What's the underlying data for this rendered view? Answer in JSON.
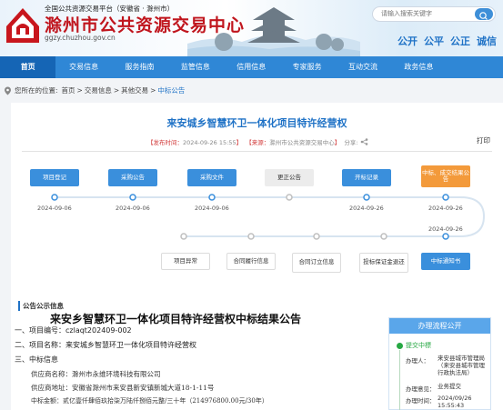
{
  "header": {
    "platform": "全国公共资源交易平台（安徽省 · 滁州市）",
    "title": "滁州市公共资源交易中心",
    "domain": "ggzy.chuzhou.gov.cn",
    "search_placeholder": "请输入搜索关键字",
    "slogans": [
      "公开",
      "公平",
      "公正",
      "诚信"
    ]
  },
  "nav": [
    {
      "label": "首页",
      "active": true
    },
    {
      "label": "交易信息",
      "active": false
    },
    {
      "label": "服务指南",
      "active": false
    },
    {
      "label": "监管信息",
      "active": false
    },
    {
      "label": "信用信息",
      "active": false
    },
    {
      "label": "专家服务",
      "active": false
    },
    {
      "label": "互动交流",
      "active": false
    },
    {
      "label": "政务信息",
      "active": false
    }
  ],
  "breadcrumb": {
    "prefix": "您所在的位置:",
    "items": [
      "首页",
      "交易信息",
      "其他交易"
    ],
    "current": "中标公告",
    "separator": ">"
  },
  "article": {
    "title": "来安城乡智慧环卫一体化项目特许经营权",
    "publish_label": "【发布时间：",
    "publish_time": "2024-09-26 15:55",
    "publish_end": "】",
    "source_label": "【来源：",
    "source": "滁州市公共资源交易中心",
    "source_end": "】",
    "share": "分享:",
    "print": "打印"
  },
  "flow": {
    "top_steps": [
      {
        "label": "项目登记",
        "style": "blue",
        "date": "2024-09-06"
      },
      {
        "label": "采购公告",
        "style": "blue",
        "date": "2024-09-06"
      },
      {
        "label": "采购文件",
        "style": "blue",
        "date": "2024-09-06"
      },
      {
        "label": "更正公告",
        "style": "grey",
        "date": ""
      },
      {
        "label": "开标记录",
        "style": "blue",
        "date": "2024-09-26"
      },
      {
        "label": "中标、成交结果公告",
        "style": "orange",
        "date": "2024-09-26"
      }
    ],
    "bottom_steps": [
      {
        "label": "项目异常",
        "style": "outline"
      },
      {
        "label": "合同履行信息",
        "style": "outline"
      },
      {
        "label": "合同订立信息",
        "style": "outline"
      },
      {
        "label": "投标保证金退还",
        "style": "outline"
      },
      {
        "label": "中标通知书",
        "style": "blue",
        "date": "2024-09-26"
      }
    ]
  },
  "announcement": {
    "section_label": "公告公示信息",
    "title": "来安乡智慧环卫一体化项目特许经营权中标结果公告",
    "lines": [
      "一、项目编号：czlaqt202409-002",
      "二、项目名称：来安城乡智慧环卫一体化项目特许经营权",
      "三、中标信息"
    ],
    "details": [
      "供应商名称：滁州市永维环境科技有限公司",
      "供应商地址：安徽省滁州市来安县新安镇新城大道18-1-11号",
      "中标金额：贰亿壹仟肆佰玖拾柒万陆仟捌佰元整/三十年（214976800.00元/30年）"
    ]
  },
  "process": {
    "title": "办理流程公开",
    "step": "提交中標",
    "rows": [
      {
        "label": "办理人：",
        "value": "来安县城市管理局（来安县城市管理行政执法局）"
      },
      {
        "label": "办理意见：",
        "value": "业务提交"
      },
      {
        "label": "办理时间：",
        "value": "2024/09/26 15:55:43"
      }
    ]
  },
  "colors": {
    "brand_red": "#c0151d",
    "nav_blue": "#2f87d6",
    "accent_blue": "#1f72c6",
    "step_orange": "#f39a3b",
    "status_green": "#27a844"
  }
}
